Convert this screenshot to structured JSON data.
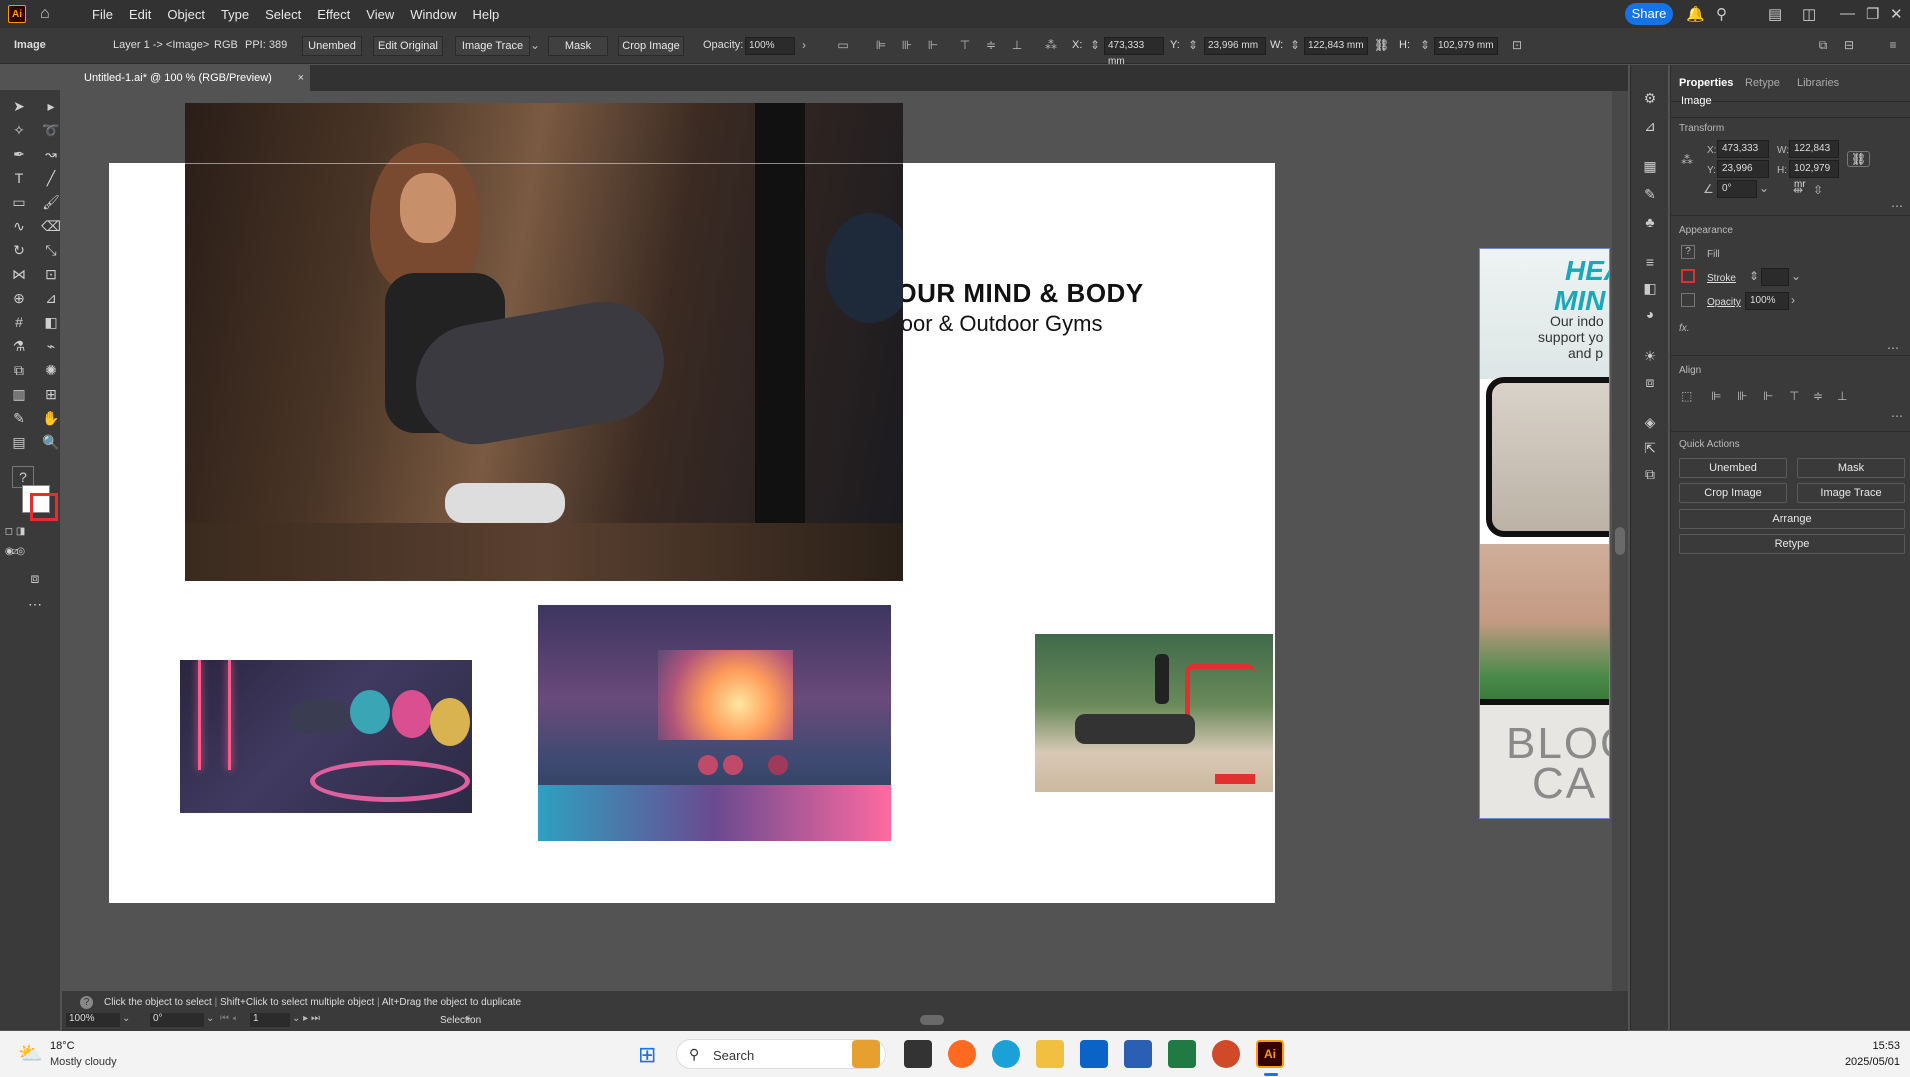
{
  "app": {
    "logo": "Ai",
    "menus": [
      "File",
      "Edit",
      "Object",
      "Type",
      "Select",
      "Effect",
      "View",
      "Window",
      "Help"
    ],
    "share_label": "Share"
  },
  "control_bar": {
    "selection_label": "Image",
    "layer_info": "Layer 1 -> <Image>",
    "color_mode": "RGB",
    "ppi": "PPI: 389",
    "unembed": "Unembed",
    "edit_original": "Edit Original",
    "image_trace": "Image Trace",
    "mask": "Mask",
    "crop_image": "Crop Image",
    "opacity_label": "Opacity:",
    "opacity_value": "100%",
    "x_label": "X:",
    "x_value": "473,333 mm",
    "y_label": "Y:",
    "y_value": "23,996 mm",
    "w_label": "W:",
    "w_value": "122,843 mm",
    "h_label": "H:",
    "h_value": "102,979 mm"
  },
  "document_tab": {
    "title": "Untitled-1.ai* @ 100 % (RGB/Preview)",
    "close": "×"
  },
  "artboard": {
    "headline": "HEAL YOUR MIND & BODY",
    "subheadline": "h Our Indoor & Outdoor Gyms"
  },
  "offboard": {
    "line1": "HEA",
    "line2": "MIN",
    "body1": "Our indo",
    "body2": "support yo",
    "body3": "and p",
    "blog1": "BLOG",
    "blog2": "CA"
  },
  "properties": {
    "tabs": [
      "Properties",
      "Retype",
      "Libraries"
    ],
    "type": "Image",
    "transform_title": "Transform",
    "x_label": "X:",
    "x_value": "473,333 mr",
    "y_label": "Y:",
    "y_value": "23,996 mm",
    "w_label": "W:",
    "w_value": "122,843 mr",
    "h_label": "H:",
    "h_value": "102,979 mr",
    "angle_value": "0°",
    "appearance_title": "Appearance",
    "fill_label": "Fill",
    "stroke_label": "Stroke",
    "opacity_label": "Opacity",
    "opacity_value": "100%",
    "fx_label": "fx.",
    "align_title": "Align",
    "quick_actions_title": "Quick Actions",
    "qa": {
      "unembed": "Unembed",
      "mask": "Mask",
      "crop": "Crop Image",
      "trace": "Image Trace",
      "arrange": "Arrange",
      "retype": "Retype"
    }
  },
  "status_bar": {
    "hint1": "Click the object to select",
    "hint2": "Shift+Click to select multiple object",
    "hint3": "Alt+Drag the object to duplicate",
    "zoom": "100%",
    "rotation": "0°",
    "artboard_num": "1",
    "tool_name": "Selection"
  },
  "taskbar": {
    "weather_temp": "18°C",
    "weather_desc": "Mostly cloudy",
    "search_placeholder": "Search",
    "time": "15:53",
    "date": "2025/05/01"
  },
  "colors": {
    "accent": "#1473e6",
    "ui_dark": "#323232",
    "ui_panel": "#3a3a3a",
    "canvas": "#535353",
    "ai_orange": "#ff9a00",
    "teal_text": "#1aa7b8"
  }
}
